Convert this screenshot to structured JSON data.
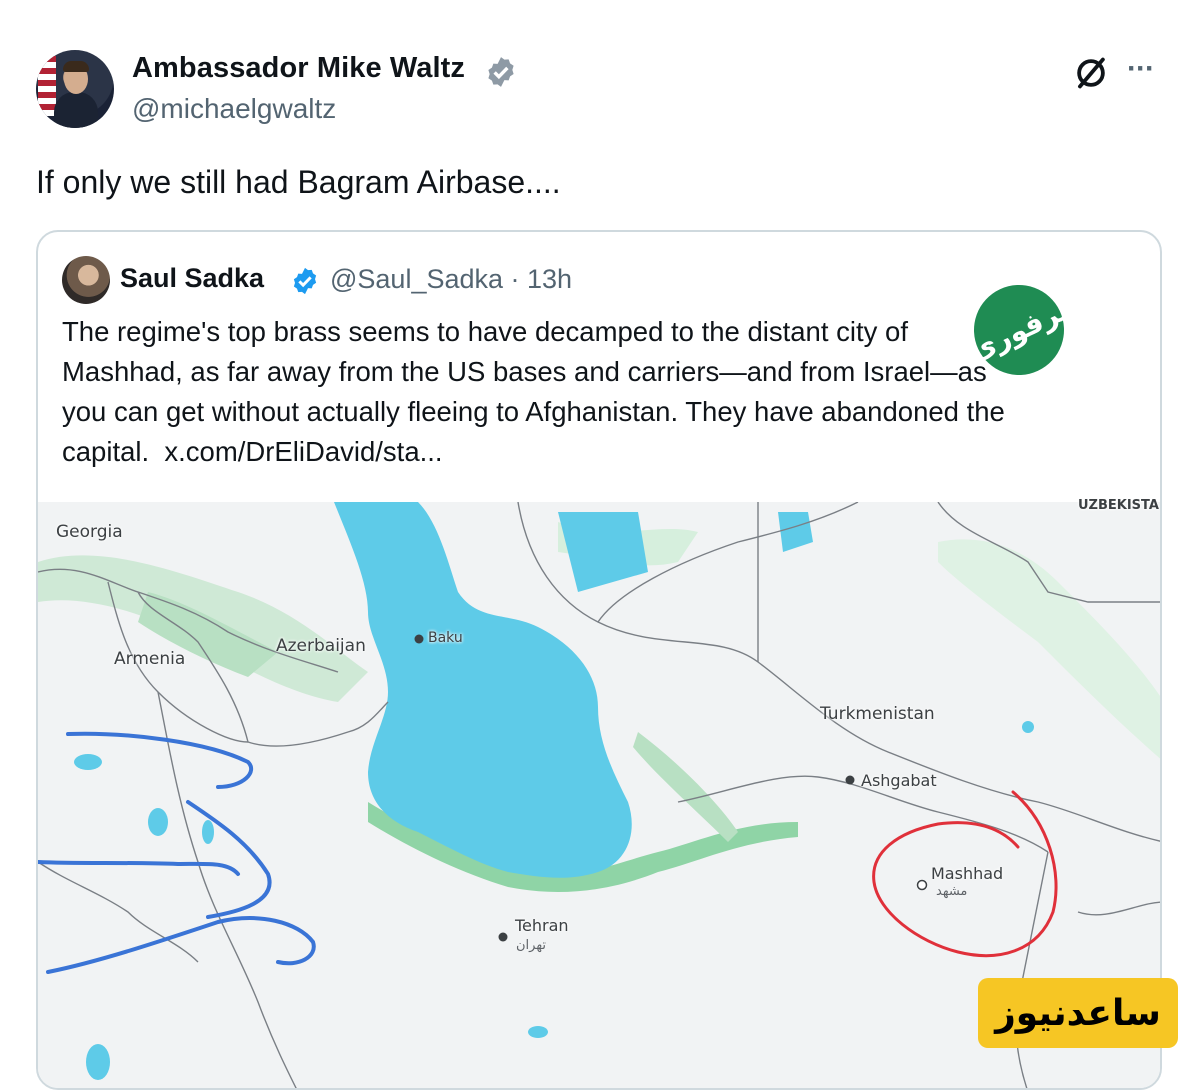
{
  "post": {
    "author_name": "Ambassador Mike Waltz",
    "author_handle": "@michaelgwaltz",
    "text": "If only we still had Bagram Airbase....",
    "more_label": "···"
  },
  "quote": {
    "author_name": "Saul Sadka",
    "author_handle_time": "@Saul_Sadka · 13h",
    "text_lines": [
      "The regime's top brass seems to have decamped to the distant city of",
      "Mashhad, as far away from the US bases and carriers—and from Israel—as",
      "you can get without actually fleeing to Afghanistan. They have abandoned the",
      "capital."
    ],
    "link": "x.com/DrEliDavid/sta..."
  },
  "map": {
    "labels": {
      "georgia": "Georgia",
      "armenia": "Armenia",
      "azerbaijan": "Azerbaijan",
      "baku": "Baku",
      "turkmenistan": "Turkmenistan",
      "ashgabat": "Ashgabat",
      "mashhad": "Mashhad",
      "mashhad_fa": "مشهد",
      "tehran": "Tehran",
      "tehran_fa": "تهران",
      "uzbekistan_partial": "UZBEKISTA"
    }
  },
  "branding": {
    "logo_text": "برفوری",
    "watermark_text": "ساعدنیوز"
  },
  "colors": {
    "verified": "#1d9bf0",
    "secondary_text": "#536471",
    "sea": "#5ecbe8",
    "land": "#f1f3f4",
    "annotation_blue": "#3a74d6",
    "annotation_red": "#e0303a",
    "watermark_bg": "#f6c624",
    "logo_bg": "#1f8c53"
  }
}
